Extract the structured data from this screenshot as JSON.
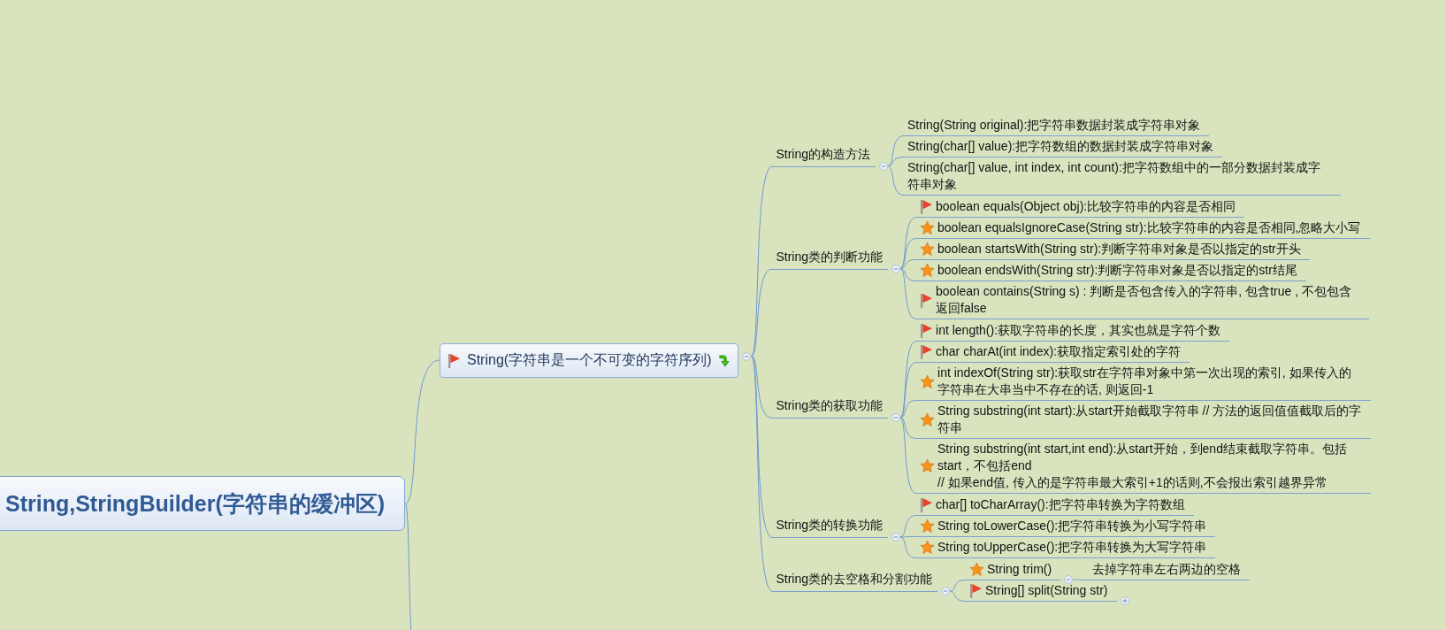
{
  "map": {
    "root": {
      "title": "String,StringBuilder(字符串的缓冲区)"
    },
    "branch": {
      "title": "String(字符串是一个不可变的字符序列)",
      "flag": true,
      "drill_down": true,
      "expanded": true,
      "children": [
        {
          "title": "String的构造方法",
          "expanded": true,
          "children": [
            {
              "title": "String(String original):把字符串数据封装成字符串对象"
            },
            {
              "title": "String(char[] value):把字符数组的数据封装成字符串对象"
            },
            {
              "title": "String(char[] value, int index, int count):把字符数组中的一部分数据封装成字符串对象"
            }
          ]
        },
        {
          "title": "String类的判断功能",
          "expanded": true,
          "children": [
            {
              "title": "boolean equals(Object obj):比较字符串的内容是否相同",
              "flag": true
            },
            {
              "title": "boolean equalsIgnoreCase(String str):比较字符串的内容是否相同,忽略大小写",
              "star": true
            },
            {
              "title": "boolean startsWith(String str):判断字符串对象是否以指定的str开头",
              "star": true
            },
            {
              "title": "boolean endsWith(String str):判断字符串对象是否以指定的str结尾",
              "star": true
            },
            {
              "title": "boolean contains(String s) : 判断是否包含传入的字符串, 包含true , 不包包含返回false",
              "flag": true
            }
          ]
        },
        {
          "title": "String类的获取功能",
          "expanded": true,
          "children": [
            {
              "title": "int length():获取字符串的长度，其实也就是字符个数",
              "flag": true
            },
            {
              "title": "char charAt(int index):获取指定索引处的字符",
              "flag": true
            },
            {
              "title": "int indexOf(String str):获取str在字符串对象中第一次出现的索引, 如果传入的字符串在大串当中不存在的话, 则返回-1",
              "star": true
            },
            {
              "title": "String substring(int start):从start开始截取字符串    // 方法的返回值值截取后的字符串",
              "star": true
            },
            {
              "title": "String substring(int start,int end):从start开始，到end结束截取字符串。包括start，不包括end\n// 如果end值, 传入的是字符串最大索引+1的话则,不会报出索引越界异常",
              "star": true
            }
          ]
        },
        {
          "title": "String类的转换功能",
          "expanded": true,
          "children": [
            {
              "title": "char[] toCharArray():把字符串转换为字符数组",
              "flag": true
            },
            {
              "title": "String toLowerCase():把字符串转换为小写字符串",
              "star": true
            },
            {
              "title": "String toUpperCase():把字符串转换为大写字符串",
              "star": true
            }
          ]
        },
        {
          "title": "String类的去空格和分割功能",
          "expanded": true,
          "children": [
            {
              "title": "String trim()",
              "star": true,
              "expanded": true,
              "children": [
                {
                  "title": "去掉字符串左右两边的空格"
                }
              ]
            },
            {
              "title": "String[] split(String str)",
              "flag": true,
              "expanded": false
            }
          ]
        }
      ]
    }
  }
}
